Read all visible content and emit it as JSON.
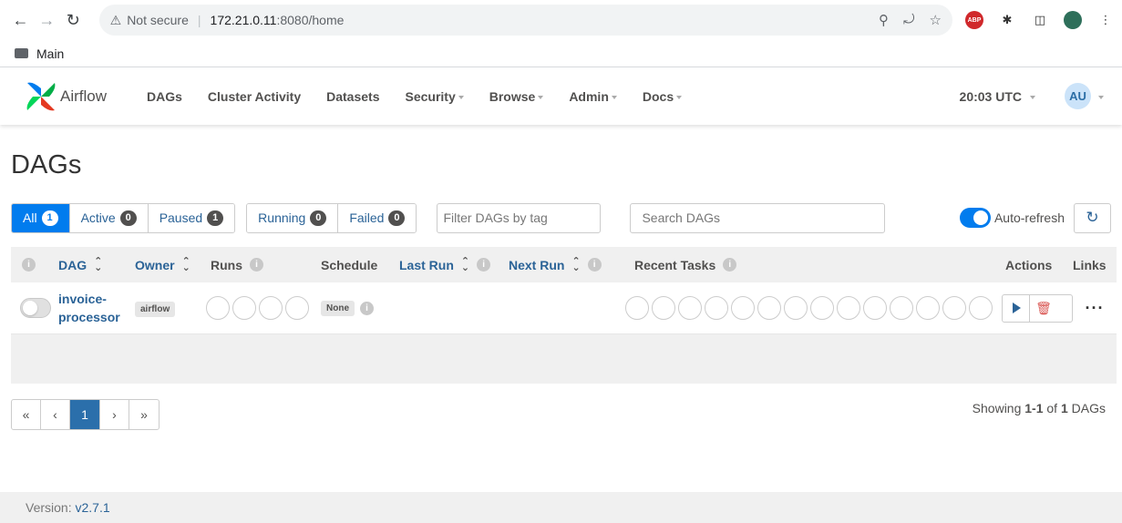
{
  "browser": {
    "security_label": "Not secure",
    "url_host": "172.21.0.11",
    "url_path": ":8080/home",
    "bookmark_folder": "Main",
    "ext_abp": "ABP"
  },
  "navbar": {
    "brand": "Airflow",
    "items": [
      "DAGs",
      "Cluster Activity",
      "Datasets",
      "Security",
      "Browse",
      "Admin",
      "Docs"
    ],
    "time": "20:03 UTC",
    "user_initials": "AU"
  },
  "page": {
    "title": "DAGs",
    "filters": {
      "all": {
        "label": "All",
        "count": "1"
      },
      "active": {
        "label": "Active",
        "count": "0"
      },
      "paused": {
        "label": "Paused",
        "count": "1"
      },
      "running": {
        "label": "Running",
        "count": "0"
      },
      "failed": {
        "label": "Failed",
        "count": "0"
      }
    },
    "tag_placeholder": "Filter DAGs by tag",
    "search_placeholder": "Search DAGs",
    "auto_refresh_label": "Auto-refresh"
  },
  "table": {
    "headers": {
      "dag": "DAG",
      "owner": "Owner",
      "runs": "Runs",
      "schedule": "Schedule",
      "last_run": "Last Run",
      "next_run": "Next Run",
      "recent_tasks": "Recent Tasks",
      "actions": "Actions",
      "links": "Links"
    },
    "rows": [
      {
        "dag_line1": "invoice-",
        "dag_line2": "processor",
        "owner": "airflow",
        "schedule": "None",
        "paused": true
      }
    ]
  },
  "pagination": {
    "first": "«",
    "prev": "‹",
    "current": "1",
    "next": "›",
    "last": "»",
    "showing_prefix": "Showing ",
    "showing_range": "1-1",
    "showing_of": " of ",
    "showing_total": "1",
    "showing_suffix": " DAGs"
  },
  "footer": {
    "version_label": "Version: ",
    "version_value": "v2.7.1"
  }
}
